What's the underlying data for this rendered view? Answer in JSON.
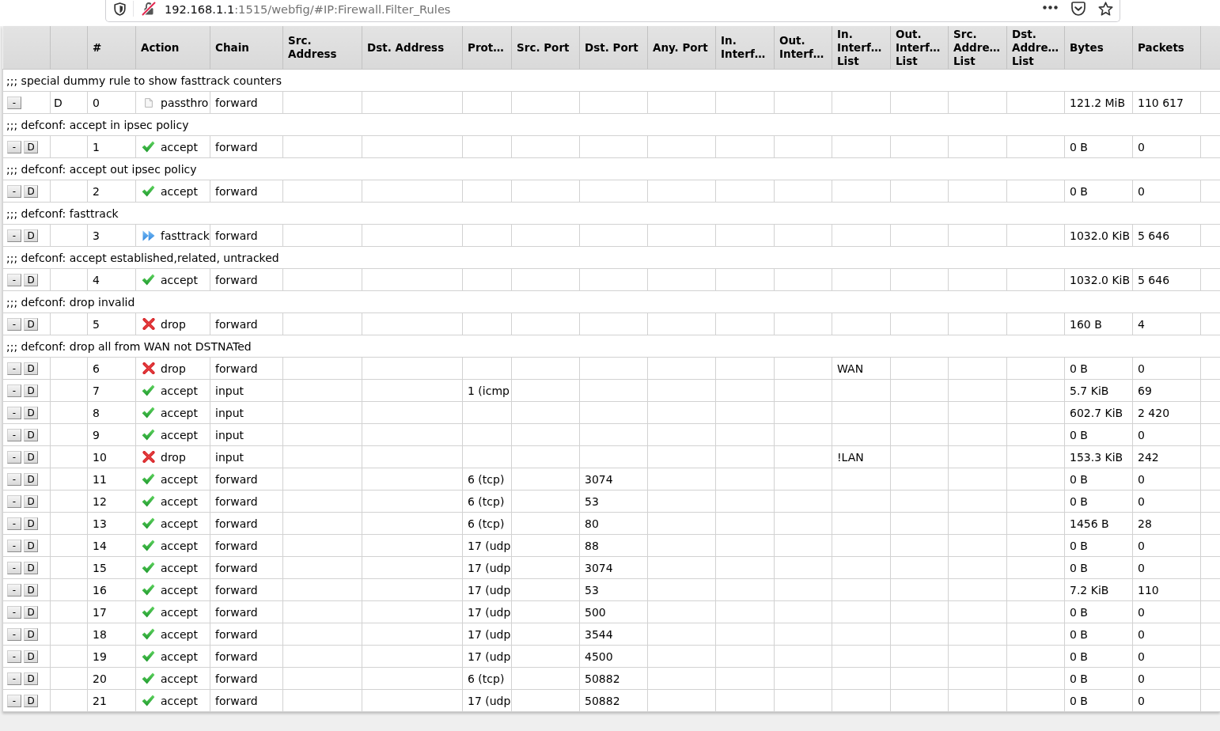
{
  "browser": {
    "url": {
      "host": "192.168.1.1",
      "rest": ":1515/webfig/#IP:Firewall.Filter_Rules"
    }
  },
  "table": {
    "columns": [
      "#",
      "Action",
      "Chain",
      "Src. Address",
      "Dst. Address",
      "Prot…",
      "Src. Port",
      "Dst. Port",
      "Any. Port",
      "In. Interf…",
      "Out. Interf…",
      "In. Interf… List",
      "Out. Interf… List",
      "Src. Addre… List",
      "Dst. Addre… List",
      "Bytes",
      "Packets"
    ],
    "rows": [
      {
        "kind": "comment",
        "text": ";;; special dummy rule to show fasttrack counters"
      },
      {
        "kind": "rule",
        "buttons": [
          "-"
        ],
        "flag": "D",
        "number": "0",
        "action": {
          "kind": "passthrough",
          "label": "passthro"
        },
        "chain": "forward",
        "bytes": "121.2 MiB",
        "packets": "110 617"
      },
      {
        "kind": "comment",
        "text": ";;; defconf: accept in ipsec policy"
      },
      {
        "kind": "rule",
        "buttons": [
          "-",
          "D"
        ],
        "number": "1",
        "action": {
          "kind": "accept",
          "label": "accept"
        },
        "chain": "forward",
        "bytes": "0 B",
        "packets": "0"
      },
      {
        "kind": "comment",
        "text": ";;; defconf: accept out ipsec policy"
      },
      {
        "kind": "rule",
        "buttons": [
          "-",
          "D"
        ],
        "number": "2",
        "action": {
          "kind": "accept",
          "label": "accept"
        },
        "chain": "forward",
        "bytes": "0 B",
        "packets": "0"
      },
      {
        "kind": "comment",
        "text": ";;; defconf: fasttrack"
      },
      {
        "kind": "rule",
        "buttons": [
          "-",
          "D"
        ],
        "number": "3",
        "action": {
          "kind": "fasttrack",
          "label": "fasttrack"
        },
        "chain": "forward",
        "bytes": "1032.0 KiB",
        "packets": "5 646"
      },
      {
        "kind": "comment",
        "text": ";;; defconf: accept established,related, untracked"
      },
      {
        "kind": "rule",
        "buttons": [
          "-",
          "D"
        ],
        "number": "4",
        "action": {
          "kind": "accept",
          "label": "accept"
        },
        "chain": "forward",
        "bytes": "1032.0 KiB",
        "packets": "5 646"
      },
      {
        "kind": "comment",
        "text": ";;; defconf: drop invalid"
      },
      {
        "kind": "rule",
        "buttons": [
          "-",
          "D"
        ],
        "number": "5",
        "action": {
          "kind": "drop",
          "label": "drop"
        },
        "chain": "forward",
        "bytes": "160 B",
        "packets": "4"
      },
      {
        "kind": "comment",
        "text": ";;; defconf: drop all from WAN not DSTNATed"
      },
      {
        "kind": "rule",
        "buttons": [
          "-",
          "D"
        ],
        "number": "6",
        "action": {
          "kind": "drop",
          "label": "drop"
        },
        "chain": "forward",
        "in_interface_list": "WAN",
        "bytes": "0 B",
        "packets": "0"
      },
      {
        "kind": "rule",
        "buttons": [
          "-",
          "D"
        ],
        "number": "7",
        "action": {
          "kind": "accept",
          "label": "accept"
        },
        "chain": "input",
        "protocol": "1 (icmp",
        "bytes": "5.7 KiB",
        "packets": "69"
      },
      {
        "kind": "rule",
        "buttons": [
          "-",
          "D"
        ],
        "number": "8",
        "action": {
          "kind": "accept",
          "label": "accept"
        },
        "chain": "input",
        "bytes": "602.7 KiB",
        "packets": "2 420"
      },
      {
        "kind": "rule",
        "buttons": [
          "-",
          "D"
        ],
        "number": "9",
        "action": {
          "kind": "accept",
          "label": "accept"
        },
        "chain": "input",
        "bytes": "0 B",
        "packets": "0"
      },
      {
        "kind": "rule",
        "buttons": [
          "-",
          "D"
        ],
        "number": "10",
        "action": {
          "kind": "drop",
          "label": "drop"
        },
        "chain": "input",
        "in_interface_list": "!LAN",
        "bytes": "153.3 KiB",
        "packets": "242"
      },
      {
        "kind": "rule",
        "buttons": [
          "-",
          "D"
        ],
        "number": "11",
        "action": {
          "kind": "accept",
          "label": "accept"
        },
        "chain": "forward",
        "protocol": "6 (tcp)",
        "dst_port": "3074",
        "bytes": "0 B",
        "packets": "0"
      },
      {
        "kind": "rule",
        "buttons": [
          "-",
          "D"
        ],
        "number": "12",
        "action": {
          "kind": "accept",
          "label": "accept"
        },
        "chain": "forward",
        "protocol": "6 (tcp)",
        "dst_port": "53",
        "bytes": "0 B",
        "packets": "0"
      },
      {
        "kind": "rule",
        "buttons": [
          "-",
          "D"
        ],
        "number": "13",
        "action": {
          "kind": "accept",
          "label": "accept"
        },
        "chain": "forward",
        "protocol": "6 (tcp)",
        "dst_port": "80",
        "bytes": "1456 B",
        "packets": "28"
      },
      {
        "kind": "rule",
        "buttons": [
          "-",
          "D"
        ],
        "number": "14",
        "action": {
          "kind": "accept",
          "label": "accept"
        },
        "chain": "forward",
        "protocol": "17 (udp",
        "dst_port": "88",
        "bytes": "0 B",
        "packets": "0"
      },
      {
        "kind": "rule",
        "buttons": [
          "-",
          "D"
        ],
        "number": "15",
        "action": {
          "kind": "accept",
          "label": "accept"
        },
        "chain": "forward",
        "protocol": "17 (udp",
        "dst_port": "3074",
        "bytes": "0 B",
        "packets": "0"
      },
      {
        "kind": "rule",
        "buttons": [
          "-",
          "D"
        ],
        "number": "16",
        "action": {
          "kind": "accept",
          "label": "accept"
        },
        "chain": "forward",
        "protocol": "17 (udp",
        "dst_port": "53",
        "bytes": "7.2 KiB",
        "packets": "110"
      },
      {
        "kind": "rule",
        "buttons": [
          "-",
          "D"
        ],
        "number": "17",
        "action": {
          "kind": "accept",
          "label": "accept"
        },
        "chain": "forward",
        "protocol": "17 (udp",
        "dst_port": "500",
        "bytes": "0 B",
        "packets": "0"
      },
      {
        "kind": "rule",
        "buttons": [
          "-",
          "D"
        ],
        "number": "18",
        "action": {
          "kind": "accept",
          "label": "accept"
        },
        "chain": "forward",
        "protocol": "17 (udp",
        "dst_port": "3544",
        "bytes": "0 B",
        "packets": "0"
      },
      {
        "kind": "rule",
        "buttons": [
          "-",
          "D"
        ],
        "number": "19",
        "action": {
          "kind": "accept",
          "label": "accept"
        },
        "chain": "forward",
        "protocol": "17 (udp",
        "dst_port": "4500",
        "bytes": "0 B",
        "packets": "0"
      },
      {
        "kind": "rule",
        "buttons": [
          "-",
          "D"
        ],
        "number": "20",
        "action": {
          "kind": "accept",
          "label": "accept"
        },
        "chain": "forward",
        "protocol": "6 (tcp)",
        "dst_port": "50882",
        "bytes": "0 B",
        "packets": "0"
      },
      {
        "kind": "rule",
        "buttons": [
          "-",
          "D"
        ],
        "number": "21",
        "action": {
          "kind": "accept",
          "label": "accept"
        },
        "chain": "forward",
        "protocol": "17 (udp",
        "dst_port": "50882",
        "bytes": "0 B",
        "packets": "0"
      }
    ]
  }
}
